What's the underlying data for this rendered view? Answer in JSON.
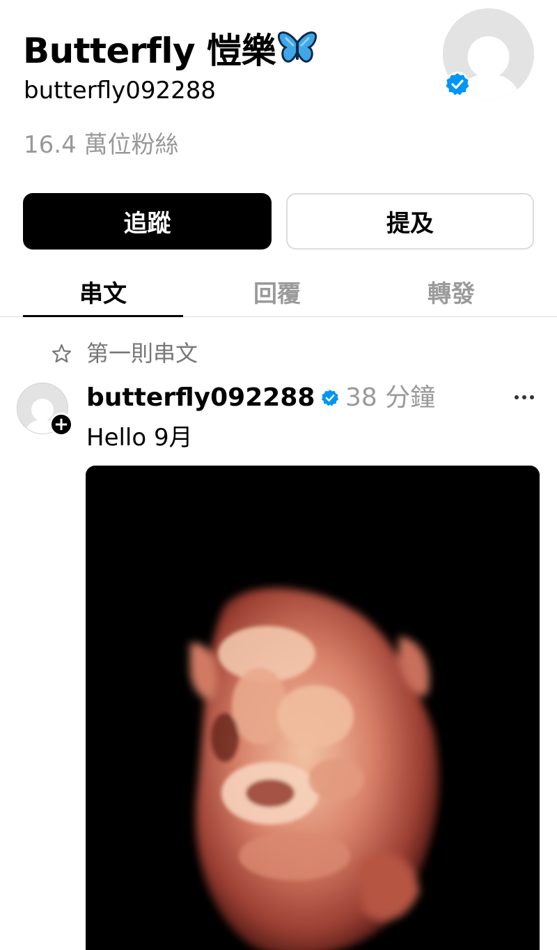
{
  "profile": {
    "display_name": "Butterfly 愷樂",
    "name_emoji_icon": "butterfly-emoji",
    "username": "butterfly092288",
    "followers_text": "16.4 萬位粉絲",
    "verified": true
  },
  "actions": {
    "follow_label": "追蹤",
    "mention_label": "提及"
  },
  "tabs": [
    {
      "label": "串文",
      "active": true
    },
    {
      "label": "回覆",
      "active": false
    },
    {
      "label": "轉發",
      "active": false
    }
  ],
  "pinned": {
    "icon": "star-outline-icon",
    "label": "第一則串文"
  },
  "post": {
    "author": "butterfly092288",
    "verified": true,
    "time": "38 分鐘",
    "text": "Hello 9月",
    "more_icon": "more-horizontal-icon",
    "image": "ultrasound-photo"
  },
  "colors": {
    "verified_blue": "#0095f6",
    "muted_text": "#999999",
    "button_dark": "#000000",
    "button_border": "#dcdcdc"
  }
}
